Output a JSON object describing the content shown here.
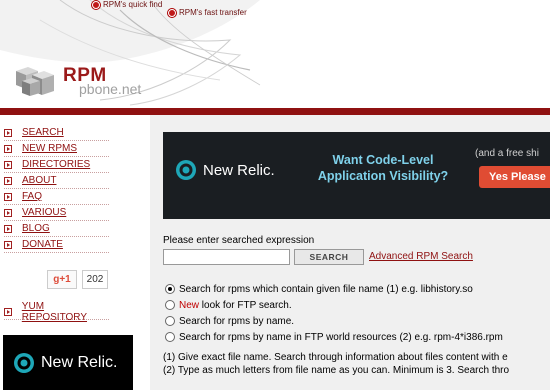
{
  "header": {
    "top_links": [
      "RPM's quick find",
      "RPM's fast transfer"
    ],
    "logo_main": "RPM",
    "logo_sub": "pbone.net"
  },
  "sidebar": {
    "items": [
      {
        "label": "SEARCH"
      },
      {
        "label": "NEW RPMS"
      },
      {
        "label": "DIRECTORIES"
      },
      {
        "label": "ABOUT"
      },
      {
        "label": "FAQ"
      },
      {
        "label": "VARIOUS"
      },
      {
        "label": "BLOG"
      },
      {
        "label": "DONATE"
      }
    ],
    "gplus_label": "g+1",
    "gplus_count": "202",
    "yum_label": "YUM REPOSITORY",
    "ad_brand": "New Relic."
  },
  "banner": {
    "brand": "New Relic.",
    "headline_1": "Want Code-Level",
    "headline_2": "Application Visibility?",
    "sub": "(and a free shi",
    "cta": "Yes Please"
  },
  "search": {
    "label": "Please enter searched expression",
    "value": "",
    "button": "SEARCH",
    "advanced_link": "Advanced RPM Search"
  },
  "options": [
    {
      "pre": "",
      "new": "",
      "text": "Search for rpms which contain given file name (1) e.g. libhistory.so",
      "checked": true
    },
    {
      "pre": "",
      "new": "New",
      "text": " look for FTP search.",
      "checked": false
    },
    {
      "pre": "",
      "new": "",
      "text": "Search for rpms by name.",
      "checked": false
    },
    {
      "pre": "",
      "new": "",
      "text": "Search for rpms by name in FTP world resources (2) e.g. rpm-4*i386.rpm",
      "checked": false
    }
  ],
  "help": {
    "line1": "(1) Give exact file name. Search through information about files content with e",
    "line2": "(2) Type as much letters from file name as you can. Minimum is 3. Search thro"
  },
  "colors": {
    "brand_red": "#8f1111",
    "banner_bg": "#1a1e22",
    "cta": "#e04c33",
    "headline": "#7fd1ea"
  }
}
